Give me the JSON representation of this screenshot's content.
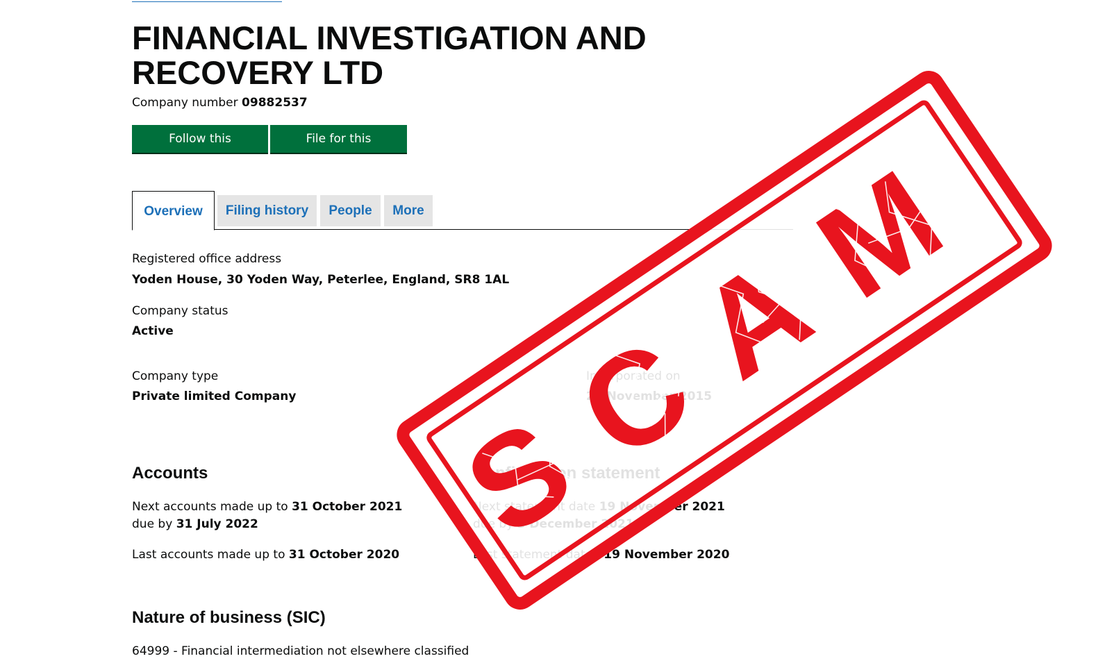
{
  "company": {
    "name": "FINANCIAL INVESTIGATION AND RECOVERY LTD",
    "number_label": "Company number",
    "number": "09882537"
  },
  "actions": {
    "follow_label": "Follow this company",
    "file_label": "File for this company"
  },
  "tabs": [
    {
      "label": "Overview",
      "active": true
    },
    {
      "label": "Filing history",
      "active": false
    },
    {
      "label": "People",
      "active": false
    },
    {
      "label": "More",
      "active": false
    }
  ],
  "overview": {
    "address_label": "Registered office address",
    "address_value": "Yoden House, 30 Yoden Way, Peterlee, England, SR8 1AL",
    "status_label": "Company status",
    "status_value": "Active",
    "type_label": "Company type",
    "type_value": "Private limited Company",
    "incorporated_label": "Incorporated on",
    "incorporated_value": "20 November 2015"
  },
  "accounts": {
    "heading": "Accounts",
    "next_prefix": "Next accounts made up to",
    "next_date": "31 October 2021",
    "due_prefix": "due by",
    "due_date": "31 July 2022",
    "last_prefix": "Last accounts made up to",
    "last_date": "31 October 2020"
  },
  "confirmation": {
    "heading": "Confirmation statement",
    "next_prefix": "Next statement date",
    "next_date": "19 November 2021",
    "due_prefix": "due by",
    "due_date": "3 December 2021",
    "last_prefix": "Last statement dated",
    "last_date": "19 November 2020"
  },
  "sic": {
    "heading": "Nature of business (SIC)",
    "entry": "64999 - Financial intermediation not elsewhere classified"
  },
  "stamp": {
    "text": "SCAM",
    "color": "#e8141e"
  },
  "colors": {
    "button_green": "#00703c",
    "link_blue": "#1d70b8",
    "tab_grey": "#e5e5e5"
  }
}
